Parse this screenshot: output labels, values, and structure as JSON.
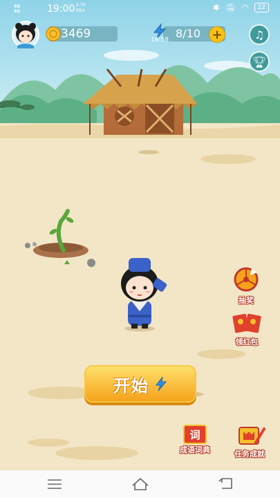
{
  "status_bar": {
    "signal_1": "4G",
    "signal_2": "4G",
    "time": "19:00",
    "speed_value": "0.70",
    "speed_unit": "KB/s",
    "battery": "22"
  },
  "hud": {
    "coins": "3469",
    "energy": "8/10",
    "energy_timer": "18:58",
    "plus_label": "+",
    "music_icon": "music-note-icon",
    "trophy_icon": "trophy-icon"
  },
  "actions": {
    "start_label": "开始",
    "lottery_label": "抽奖",
    "red_packet_label": "领红包",
    "dictionary_label": "成语词典",
    "dictionary_badge": "词",
    "achievements_label": "任务成就"
  },
  "colors": {
    "sky": "#bfe7f2",
    "sand": "#f3e6c6",
    "accent_orange": "#f6a21b",
    "red": "#e0402c"
  }
}
